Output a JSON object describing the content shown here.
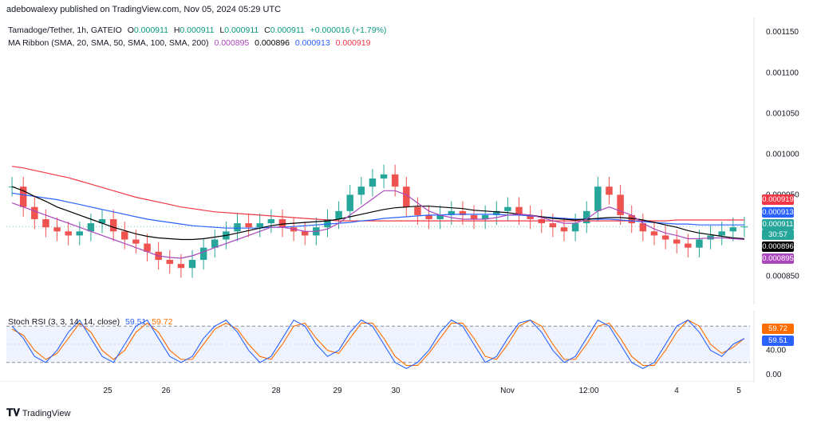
{
  "header": {
    "text": "adebowalexy published on TradingView.com, Nov 05, 2024 05:29 UTC"
  },
  "legend": {
    "symbol": "Tamadoge/Tether, 1h, GATEIO",
    "open_label": "O",
    "open": "0.000911",
    "high_label": "H",
    "high": "0.000911",
    "low_label": "L",
    "low": "0.000911",
    "close_label": "C",
    "close": "0.000911",
    "change": "+0.000016 (+1.79%)",
    "ma_ribbon": "MA Ribbon (SMA, 20, SMA, 50, SMA, 100, SMA, 200)",
    "ma1": "0.000895",
    "ma2": "0.000896",
    "ma3": "0.000913",
    "ma4": "0.000919",
    "stoch": "Stoch RSI (3, 3, 14, 14, close)",
    "stoch_k": "59.51",
    "stoch_d": "59.72"
  },
  "colors": {
    "up": "#26a69a",
    "down": "#ef5350",
    "ma20": "#ab47bc",
    "ma50": "#000000",
    "ma100": "#2962ff",
    "ma200": "#f23645",
    "stoch_k": "#2962ff",
    "stoch_d": "#ff6d00"
  },
  "price_tags": [
    {
      "value": "0.000919",
      "color": "#f23645"
    },
    {
      "value": "0.000913",
      "color": "#2962ff"
    },
    {
      "value": "0.000911",
      "color": "#26a69a"
    },
    {
      "value": "30:57",
      "color": "#26a69a"
    },
    {
      "value": "0.000896",
      "color": "#000000"
    },
    {
      "value": "0.000895",
      "color": "#ab47bc"
    }
  ],
  "stoch_tags": [
    {
      "value": "59.72",
      "color": "#ff6d00"
    },
    {
      "value": "59.51",
      "color": "#2962ff"
    }
  ],
  "footer": {
    "text": "TradingView"
  },
  "chart_data": {
    "type": "candlestick",
    "price_axis": {
      "ticks": [
        "0.001150",
        "0.001100",
        "0.001050",
        "0.001000",
        "0.000950",
        "0.000850"
      ],
      "ylim": [
        0.000825,
        0.00116
      ]
    },
    "stoch_axis": {
      "ticks": [
        "40.00",
        "0.00"
      ],
      "ylim": [
        0,
        100
      ]
    },
    "x_ticks": [
      "25",
      "26",
      "28",
      "29",
      "30",
      "Nov",
      "12:00",
      "4",
      "5"
    ],
    "close_approx": [
      0.00096,
      0.000935,
      0.00092,
      0.00091,
      0.000905,
      0.0009,
      0.000905,
      0.000915,
      0.00092,
      0.000905,
      0.000895,
      0.00089,
      0.00088,
      0.00087,
      0.000865,
      0.00086,
      0.00087,
      0.000885,
      0.000895,
      0.000905,
      0.000915,
      0.00091,
      0.000915,
      0.00092,
      0.00091,
      0.000905,
      0.0009,
      0.00091,
      0.00092,
      0.00093,
      0.00095,
      0.00096,
      0.00097,
      0.000975,
      0.00096,
      0.000935,
      0.000925,
      0.00092,
      0.000925,
      0.00093,
      0.000925,
      0.00092,
      0.000925,
      0.00093,
      0.000935,
      0.000925,
      0.00092,
      0.000915,
      0.00091,
      0.000905,
      0.000915,
      0.00093,
      0.00096,
      0.00095,
      0.000925,
      0.000915,
      0.000905,
      0.0009,
      0.000895,
      0.00089,
      0.000885,
      0.000895,
      0.0009,
      0.000905,
      0.00091,
      0.000911
    ],
    "ma20_approx": [
      0.00094,
      0.000935,
      0.00093,
      0.000925,
      0.00092,
      0.000915,
      0.00091,
      0.000905,
      0.0009,
      0.000895,
      0.00089,
      0.000885,
      0.00088,
      0.000875,
      0.000873,
      0.000872,
      0.000875,
      0.00088,
      0.000885,
      0.00089,
      0.000895,
      0.0009,
      0.000905,
      0.00091,
      0.00091,
      0.000908,
      0.000905,
      0.000905,
      0.000908,
      0.000915,
      0.000925,
      0.000935,
      0.000945,
      0.000955,
      0.000955,
      0.00095,
      0.00094,
      0.00093,
      0.000925,
      0.000922,
      0.00092,
      0.00092,
      0.00092,
      0.000922,
      0.000925,
      0.000926,
      0.000925,
      0.000922,
      0.000918,
      0.000915,
      0.000915,
      0.00092,
      0.00093,
      0.000935,
      0.00093,
      0.000925,
      0.000915,
      0.000908,
      0.000903,
      0.0009,
      0.000896,
      0.000896,
      0.000897,
      0.000897,
      0.000896,
      0.000895
    ],
    "ma50_approx": [
      0.00096,
      0.000955,
      0.000948,
      0.000942,
      0.000935,
      0.00093,
      0.000925,
      0.00092,
      0.000915,
      0.00091,
      0.000906,
      0.000902,
      0.000899,
      0.000897,
      0.000896,
      0.000895,
      0.000895,
      0.000896,
      0.000898,
      0.0009,
      0.000903,
      0.000906,
      0.000909,
      0.000912,
      0.000914,
      0.000915,
      0.000916,
      0.000917,
      0.000918,
      0.00092,
      0.000923,
      0.000926,
      0.000929,
      0.000932,
      0.000934,
      0.000935,
      0.000936,
      0.000936,
      0.000935,
      0.000934,
      0.000933,
      0.000931,
      0.00093,
      0.000929,
      0.000928,
      0.000926,
      0.000925,
      0.000923,
      0.000921,
      0.00092,
      0.000919,
      0.00092,
      0.000921,
      0.000922,
      0.000922,
      0.000921,
      0.000919,
      0.000916,
      0.000913,
      0.00091,
      0.000906,
      0.000903,
      0.000901,
      0.000899,
      0.000897,
      0.000896
    ],
    "ma100_approx": [
      0.000952,
      0.00095,
      0.000948,
      0.000946,
      0.000944,
      0.000941,
      0.000938,
      0.000935,
      0.000932,
      0.000929,
      0.000926,
      0.000923,
      0.00092,
      0.000918,
      0.000916,
      0.000914,
      0.000912,
      0.000911,
      0.00091,
      0.000909,
      0.000909,
      0.000909,
      0.000909,
      0.00091,
      0.00091,
      0.000911,
      0.000912,
      0.000913,
      0.000914,
      0.000915,
      0.000916,
      0.000918,
      0.000919,
      0.000921,
      0.000922,
      0.000923,
      0.000924,
      0.000925,
      0.000925,
      0.000926,
      0.000926,
      0.000926,
      0.000926,
      0.000926,
      0.000925,
      0.000925,
      0.000924,
      0.000923,
      0.000922,
      0.000921,
      0.00092,
      0.00092,
      0.00092,
      0.00092,
      0.000919,
      0.000918,
      0.000917,
      0.000916,
      0.000915,
      0.000914,
      0.000914,
      0.000913,
      0.000913,
      0.000913,
      0.000913,
      0.000913
    ],
    "ma200_approx": [
      0.000985,
      0.000983,
      0.00098,
      0.000977,
      0.000974,
      0.000971,
      0.000967,
      0.000963,
      0.000959,
      0.000955,
      0.000951,
      0.000947,
      0.000944,
      0.000941,
      0.000938,
      0.000935,
      0.000933,
      0.000931,
      0.000929,
      0.000928,
      0.000927,
      0.000926,
      0.000925,
      0.000924,
      0.000923,
      0.000922,
      0.000921,
      0.00092,
      0.000919,
      0.000918,
      0.000918,
      0.000918,
      0.000918,
      0.000918,
      0.000918,
      0.000918,
      0.000918,
      0.000918,
      0.000918,
      0.000918,
      0.000918,
      0.000918,
      0.000918,
      0.000918,
      0.000918,
      0.000918,
      0.000918,
      0.000918,
      0.000918,
      0.000918,
      0.000918,
      0.000918,
      0.000918,
      0.000918,
      0.000918,
      0.000918,
      0.000918,
      0.000918,
      0.000918,
      0.000919,
      0.000919,
      0.000919,
      0.000919,
      0.000919,
      0.000919,
      0.000919
    ],
    "stoch_k_approx": [
      80,
      60,
      30,
      20,
      40,
      70,
      90,
      60,
      30,
      20,
      50,
      80,
      90,
      60,
      30,
      20,
      30,
      60,
      80,
      90,
      70,
      40,
      20,
      30,
      60,
      90,
      80,
      50,
      30,
      40,
      70,
      90,
      80,
      50,
      20,
      10,
      20,
      40,
      70,
      90,
      80,
      50,
      20,
      30,
      60,
      85,
      90,
      70,
      40,
      20,
      30,
      60,
      90,
      80,
      50,
      20,
      10,
      20,
      50,
      80,
      90,
      70,
      40,
      30,
      50,
      59.51
    ],
    "stoch_d_approx": [
      75,
      65,
      40,
      25,
      35,
      60,
      85,
      70,
      40,
      25,
      40,
      70,
      85,
      70,
      40,
      25,
      25,
      50,
      75,
      85,
      75,
      50,
      30,
      25,
      50,
      80,
      85,
      60,
      40,
      35,
      60,
      85,
      85,
      60,
      30,
      15,
      15,
      35,
      60,
      85,
      85,
      60,
      30,
      25,
      50,
      80,
      90,
      80,
      50,
      25,
      25,
      50,
      80,
      85,
      60,
      30,
      15,
      15,
      40,
      70,
      90,
      80,
      50,
      35,
      45,
      59.72
    ]
  }
}
